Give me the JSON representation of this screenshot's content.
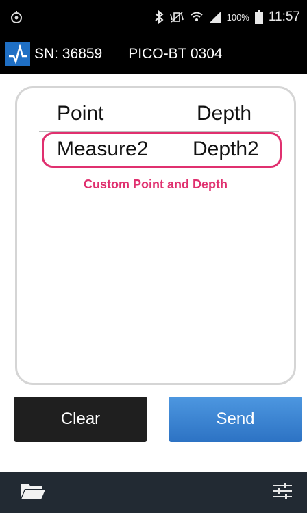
{
  "status_bar": {
    "battery_percent": "100%",
    "time": "11:57",
    "icons": [
      "power-icon",
      "bluetooth-icon",
      "mute-vibrate-icon",
      "wifi-icon",
      "signal-icon",
      "battery-icon"
    ]
  },
  "header": {
    "serial": "SN: 36859",
    "device": "PICO-BT 0304",
    "logo_icon": "pulse-logo-icon",
    "logo_color": "#1f6fc4"
  },
  "table": {
    "columns": [
      "Point",
      "Depth"
    ],
    "rows": [
      {
        "point": "Measure2",
        "depth": "Depth2"
      }
    ]
  },
  "annotation": {
    "label": "Custom Point and Depth",
    "color": "#e0306f"
  },
  "buttons": {
    "clear": "Clear",
    "send": "Send"
  },
  "bottom_bar": {
    "left_icon": "folder-icon",
    "right_icon": "settings-sliders-icon"
  }
}
